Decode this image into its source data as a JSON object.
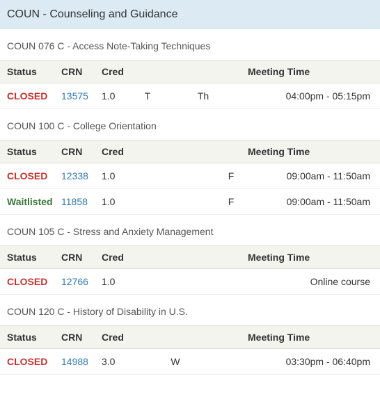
{
  "department_title": "COUN - Counseling and Guidance",
  "headers": {
    "status": "Status",
    "crn": "CRN",
    "cred": "Cred",
    "meeting": "Meeting Time"
  },
  "courses": [
    {
      "title": "COUN 076 C - Access Note-Taking Techniques",
      "sections": [
        {
          "status": "CLOSED",
          "status_kind": "closed",
          "crn": "13575",
          "cred": "1.0",
          "d1": "T",
          "d2": "",
          "d3": "Th",
          "d4": "",
          "meeting": "04:00pm - 05:15pm"
        }
      ]
    },
    {
      "title": "COUN 100 C - College Orientation",
      "sections": [
        {
          "status": "CLOSED",
          "status_kind": "closed",
          "crn": "12338",
          "cred": "1.0",
          "d1": "",
          "d2": "",
          "d3": "",
          "d4": "F",
          "meeting": "09:00am - 11:50am"
        },
        {
          "status": "Waitlisted",
          "status_kind": "waitlisted",
          "crn": "11858",
          "cred": "1.0",
          "d1": "",
          "d2": "",
          "d3": "",
          "d4": "F",
          "meeting": "09:00am - 11:50am"
        }
      ]
    },
    {
      "title": "COUN 105 C - Stress and Anxiety Management",
      "sections": [
        {
          "status": "CLOSED",
          "status_kind": "closed",
          "crn": "12766",
          "cred": "1.0",
          "d1": "",
          "d2": "",
          "d3": "",
          "d4": "",
          "meeting": "Online course"
        }
      ]
    },
    {
      "title": "COUN 120 C - History of Disability in U.S.",
      "sections": [
        {
          "status": "CLOSED",
          "status_kind": "closed",
          "crn": "14988",
          "cred": "3.0",
          "d1": "",
          "d2": "W",
          "d3": "",
          "d4": "",
          "meeting": "03:30pm - 06:40pm"
        }
      ]
    }
  ]
}
